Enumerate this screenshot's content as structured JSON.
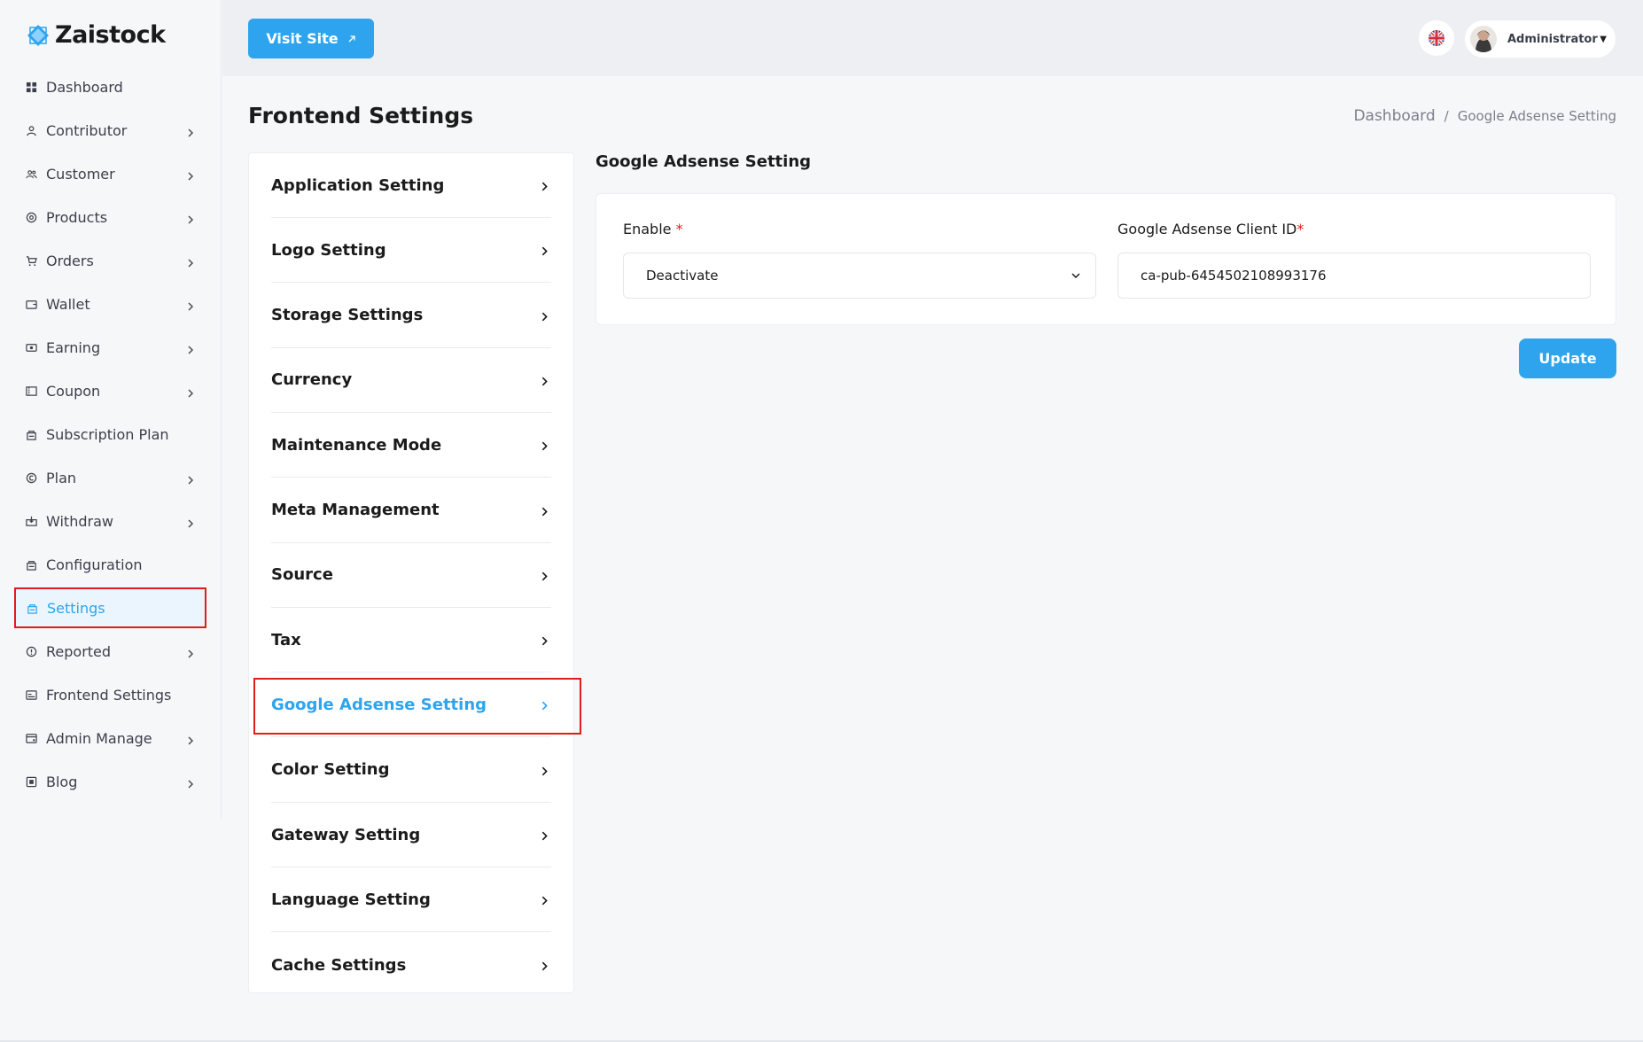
{
  "brand": {
    "name": "Zaistock",
    "accent": "#2ea4ee",
    "highlight": "#e01c1c"
  },
  "sidebar": {
    "items": [
      {
        "label": "Dashboard",
        "icon": "dashboard-icon",
        "chevron": false,
        "active": false
      },
      {
        "label": "Contributor",
        "icon": "contributor-icon",
        "chevron": true,
        "active": false
      },
      {
        "label": "Customer",
        "icon": "customer-icon",
        "chevron": true,
        "active": false
      },
      {
        "label": "Products",
        "icon": "products-icon",
        "chevron": true,
        "active": false
      },
      {
        "label": "Orders",
        "icon": "cart-icon",
        "chevron": true,
        "active": false
      },
      {
        "label": "Wallet",
        "icon": "wallet-icon",
        "chevron": true,
        "active": false
      },
      {
        "label": "Earning",
        "icon": "earning-icon",
        "chevron": true,
        "active": false
      },
      {
        "label": "Coupon",
        "icon": "coupon-icon",
        "chevron": true,
        "active": false
      },
      {
        "label": "Subscription Plan",
        "icon": "subscription-icon",
        "chevron": false,
        "active": false
      },
      {
        "label": "Plan",
        "icon": "plan-icon",
        "chevron": true,
        "active": false
      },
      {
        "label": "Withdraw",
        "icon": "withdraw-icon",
        "chevron": true,
        "active": false
      },
      {
        "label": "Configuration",
        "icon": "configuration-icon",
        "chevron": false,
        "active": false
      },
      {
        "label": "Settings",
        "icon": "settings-icon",
        "chevron": false,
        "active": true
      },
      {
        "label": "Reported",
        "icon": "reported-icon",
        "chevron": true,
        "active": false
      },
      {
        "label": "Frontend Settings",
        "icon": "frontend-settings-icon",
        "chevron": false,
        "active": false
      },
      {
        "label": "Admin Manage",
        "icon": "admin-manage-icon",
        "chevron": true,
        "active": false
      },
      {
        "label": "Blog",
        "icon": "blog-icon",
        "chevron": true,
        "active": false
      }
    ]
  },
  "header": {
    "visit_site_label": "Visit Site",
    "user_name": "Administrator",
    "language_icon": "uk-flag-icon"
  },
  "page": {
    "title": "Frontend Settings",
    "breadcrumb": {
      "home": "Dashboard",
      "separator": "/",
      "current": "Google Adsense Setting"
    }
  },
  "settings_menu": {
    "items": [
      {
        "label": "Application Setting",
        "active": false
      },
      {
        "label": "Logo Setting",
        "active": false
      },
      {
        "label": "Storage Settings",
        "active": false
      },
      {
        "label": "Currency",
        "active": false
      },
      {
        "label": "Maintenance Mode",
        "active": false
      },
      {
        "label": "Meta Management",
        "active": false
      },
      {
        "label": "Source",
        "active": false
      },
      {
        "label": "Tax",
        "active": false
      },
      {
        "label": "Google Adsense Setting",
        "active": true
      },
      {
        "label": "Color Setting",
        "active": false
      },
      {
        "label": "Gateway Setting",
        "active": false
      },
      {
        "label": "Language Setting",
        "active": false
      },
      {
        "label": "Cache Settings",
        "active": false
      }
    ]
  },
  "form": {
    "section_title": "Google Adsense Setting",
    "enable_label": "Enable",
    "enable_required": "*",
    "enable_value": "Deactivate",
    "client_id_label": "Google Adsense Client ID",
    "client_id_required": "*",
    "client_id_value": "ca-pub-6454502108993176",
    "update_label": "Update"
  }
}
